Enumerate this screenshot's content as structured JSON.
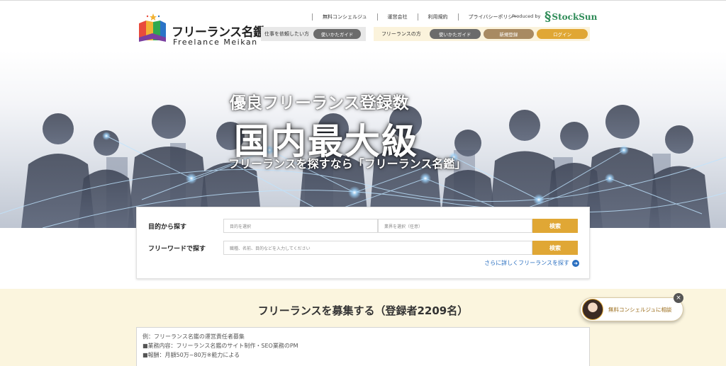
{
  "brand": {
    "logo_title": "フリーランス名鑑",
    "logo_sub": "Freelance Meikan",
    "produced_by": "Produced by",
    "producer": "StockSun",
    "colors": {
      "accent": "#e0a735",
      "brown": "#a88a62",
      "gray": "#6b6b6b",
      "link": "#2a6fc0",
      "cream": "#fbf5de"
    }
  },
  "topnav": [
    {
      "label": "無料コンシェルジュ"
    },
    {
      "label": "運営会社"
    },
    {
      "label": "利用規約"
    },
    {
      "label": "プライバシーポリシー"
    }
  ],
  "client_nav": {
    "label": "仕事を依頼したい方",
    "guide": "使いかたガイド"
  },
  "freelance_nav": {
    "label": "フリーランスの方",
    "guide": "使いかたガイド",
    "register": "新規登録",
    "login": "ログイン"
  },
  "hero": {
    "line1": "優良フリーランス登録数",
    "line2": "国内最大級",
    "line3": "フリーランスを探すなら「フリーランス名鑑」"
  },
  "search": {
    "purpose_label": "目的から探す",
    "purpose_placeholder": "目的を選択",
    "industry_placeholder": "業界を選択（任意）",
    "search_button": "検索",
    "keyword_label": "フリーワードで探す",
    "keyword_placeholder": "職種、名前、目的などを入力してください",
    "keyword_button": "検索",
    "more_link": "さらに詳しくフリーランスを探す"
  },
  "recruit": {
    "title": "フリーランスを募集する（登録者2209名）",
    "placeholder_lines": [
      "例：フリーランス名鑑の運営責任者募集",
      "■業務内容：フリーランス名鑑のサイト制作・SEO業務のPM",
      "■報酬：月額50万~80万※能力による"
    ]
  },
  "concierge": {
    "label": "無料コンシェルジュに相談",
    "close": "×"
  }
}
